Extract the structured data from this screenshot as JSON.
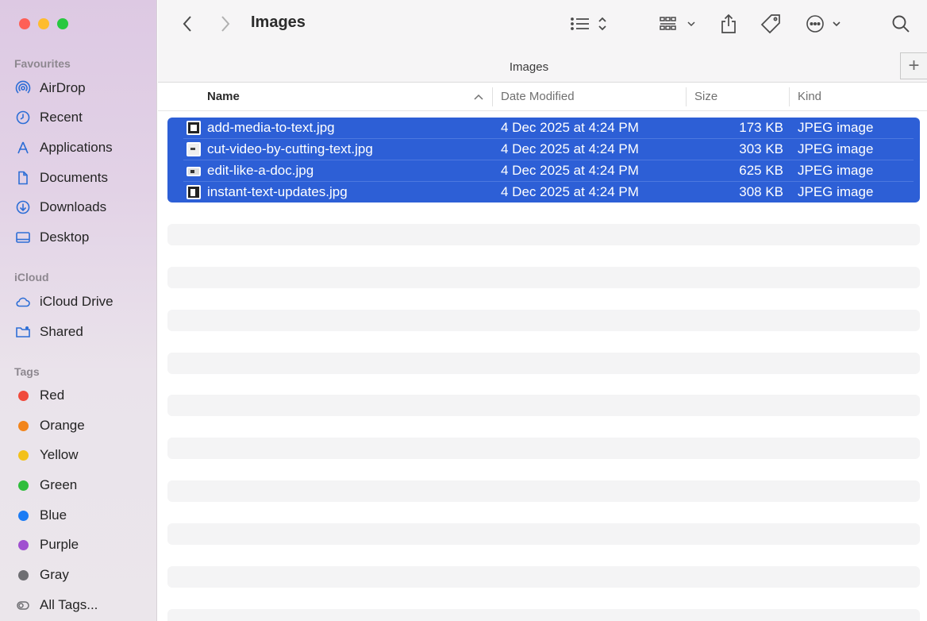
{
  "window": {
    "title": "Images"
  },
  "colors": {
    "accent": "#2d5fd6",
    "close": "#fe5f57",
    "minimize": "#febc2e",
    "zoom": "#28c840"
  },
  "sidebar": {
    "favourites_title": "Favourites",
    "favourites": [
      {
        "label": "AirDrop",
        "icon": "airdrop-icon"
      },
      {
        "label": "Recent",
        "icon": "clock-icon"
      },
      {
        "label": "Applications",
        "icon": "applications-icon"
      },
      {
        "label": "Documents",
        "icon": "document-icon"
      },
      {
        "label": "Downloads",
        "icon": "download-icon"
      },
      {
        "label": "Desktop",
        "icon": "desktop-icon"
      }
    ],
    "icloud_title": "iCloud",
    "icloud": [
      {
        "label": "iCloud Drive",
        "icon": "cloud-icon"
      },
      {
        "label": "Shared",
        "icon": "shared-folder-icon"
      }
    ],
    "tags_title": "Tags",
    "tags": [
      {
        "label": "Red",
        "color": "#f04a3c"
      },
      {
        "label": "Orange",
        "color": "#f2851b"
      },
      {
        "label": "Yellow",
        "color": "#f3c11a"
      },
      {
        "label": "Green",
        "color": "#2fbd3c"
      },
      {
        "label": "Blue",
        "color": "#1b7cf5"
      },
      {
        "label": "Purple",
        "color": "#a04fd0"
      },
      {
        "label": "Gray",
        "color": "#6e6e72"
      }
    ],
    "all_tags": "All Tags..."
  },
  "pathbar": {
    "title": "Images",
    "plus": "+"
  },
  "columns": {
    "name": "Name",
    "date": "Date Modified",
    "size": "Size",
    "kind": "Kind"
  },
  "files": [
    {
      "name": "add-media-to-text.jpg",
      "date": "4 Dec 2025 at 4:24 PM",
      "size": "173 KB",
      "kind": "JPEG image"
    },
    {
      "name": "cut-video-by-cutting-text.jpg",
      "date": "4 Dec 2025 at 4:24 PM",
      "size": "303 KB",
      "kind": "JPEG image"
    },
    {
      "name": "edit-like-a-doc.jpg",
      "date": "4 Dec 2025 at 4:24 PM",
      "size": "625 KB",
      "kind": "JPEG image"
    },
    {
      "name": "instant-text-updates.jpg",
      "date": "4 Dec 2025 at 4:24 PM",
      "size": "308 KB",
      "kind": "JPEG image"
    }
  ]
}
